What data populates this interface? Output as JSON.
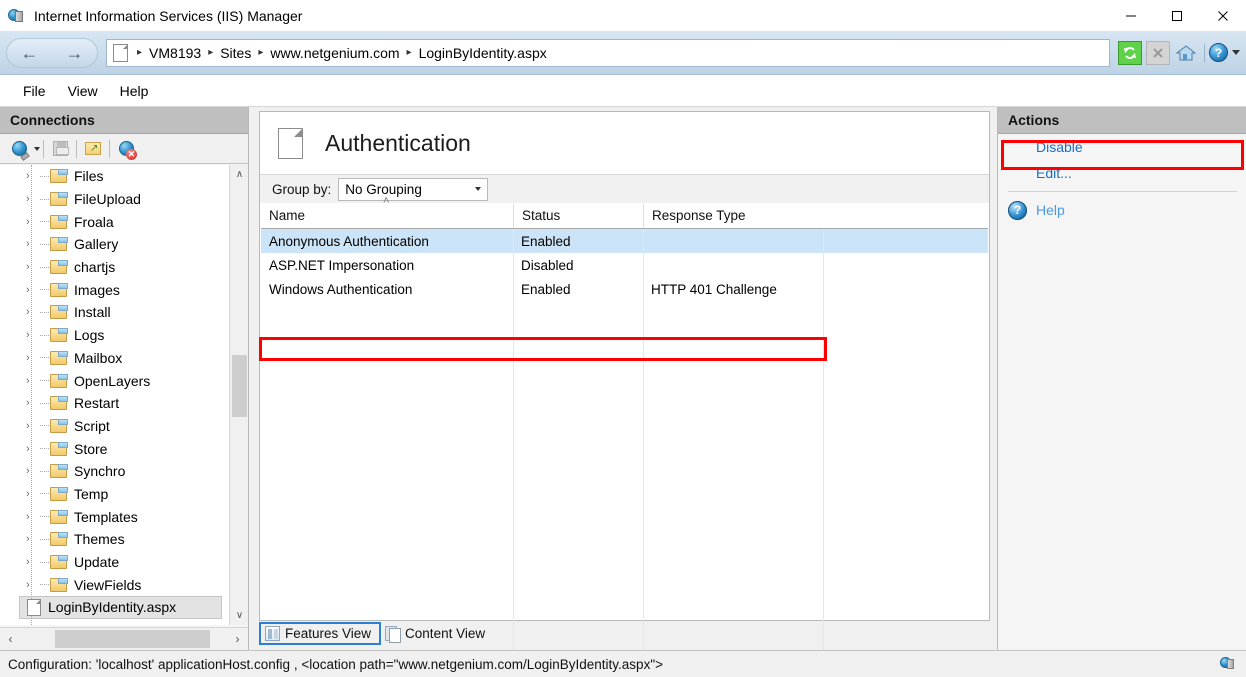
{
  "window": {
    "title": "Internet Information Services (IIS) Manager",
    "icon": "iis-server-icon",
    "minimize": "—",
    "maximize": "□",
    "close": "✕"
  },
  "address_bar": {
    "back_arrow": "←",
    "forward_arrow": "→",
    "page_icon": "page-icon",
    "separator": "▸",
    "breadcrumbs": [
      "VM8193",
      "Sites",
      "www.netgenium.com",
      "LoginByIdentity.aspx"
    ],
    "tools": [
      {
        "name": "refresh-icon",
        "glyph": "↻"
      },
      {
        "name": "stop-icon",
        "glyph": "✕"
      },
      {
        "name": "home-icon",
        "glyph": "⌂"
      },
      {
        "name": "help-icon",
        "glyph": "?"
      }
    ]
  },
  "menu": {
    "items": [
      "File",
      "View",
      "Help"
    ]
  },
  "connections": {
    "header": "Connections",
    "toolbar": [
      {
        "name": "connect-icon",
        "label": "Connect"
      },
      {
        "name": "save-connections-icon",
        "label": "Save"
      },
      {
        "name": "open-folder-icon",
        "label": "Open"
      },
      {
        "name": "disconnect-icon",
        "label": "Disconnect"
      }
    ],
    "tree": [
      {
        "label": "Files",
        "type": "folder",
        "expandable": true,
        "selected": false
      },
      {
        "label": "FileUpload",
        "type": "folder",
        "expandable": true,
        "selected": false
      },
      {
        "label": "Froala",
        "type": "folder",
        "expandable": true,
        "selected": false
      },
      {
        "label": "Gallery",
        "type": "folder",
        "expandable": true,
        "selected": false
      },
      {
        "label": "chartjs",
        "type": "folder",
        "expandable": true,
        "selected": false
      },
      {
        "label": "Images",
        "type": "folder",
        "expandable": true,
        "selected": false
      },
      {
        "label": "Install",
        "type": "folder",
        "expandable": true,
        "selected": false
      },
      {
        "label": "Logs",
        "type": "folder",
        "expandable": true,
        "selected": false
      },
      {
        "label": "Mailbox",
        "type": "folder",
        "expandable": true,
        "selected": false
      },
      {
        "label": "OpenLayers",
        "type": "folder",
        "expandable": true,
        "selected": false
      },
      {
        "label": "Restart",
        "type": "folder",
        "expandable": true,
        "selected": false
      },
      {
        "label": "Script",
        "type": "folder",
        "expandable": true,
        "selected": false
      },
      {
        "label": "Store",
        "type": "folder",
        "expandable": true,
        "selected": false
      },
      {
        "label": "Synchro",
        "type": "folder",
        "expandable": true,
        "selected": false
      },
      {
        "label": "Temp",
        "type": "folder",
        "expandable": true,
        "selected": false
      },
      {
        "label": "Templates",
        "type": "folder",
        "expandable": true,
        "selected": false
      },
      {
        "label": "Themes",
        "type": "folder",
        "expandable": true,
        "selected": false
      },
      {
        "label": "Update",
        "type": "folder",
        "expandable": true,
        "selected": false
      },
      {
        "label": "ViewFields",
        "type": "folder",
        "expandable": true,
        "selected": false
      },
      {
        "label": "LoginByIdentity.aspx",
        "type": "file",
        "expandable": false,
        "selected": true
      }
    ],
    "scroll_up": "∧",
    "scroll_down": "∨",
    "scroll_left": "‹",
    "scroll_right": "›"
  },
  "feature": {
    "icon": "page-icon",
    "title": "Authentication",
    "group_by_label": "Group by:",
    "group_by_value": "No Grouping",
    "sort_indicator": "˄",
    "columns": [
      "Name",
      "Status",
      "Response Type"
    ],
    "rows": [
      {
        "name": "Anonymous Authentication",
        "status": "Enabled",
        "response_type": "",
        "selected": true,
        "highlighted": true
      },
      {
        "name": "ASP.NET Impersonation",
        "status": "Disabled",
        "response_type": "",
        "selected": false,
        "highlighted": false
      },
      {
        "name": "Windows Authentication",
        "status": "Enabled",
        "response_type": "HTTP 401 Challenge",
        "selected": false,
        "highlighted": false
      }
    ]
  },
  "view_tabs": [
    {
      "label": "Features View",
      "icon": "features-view-icon",
      "active": true
    },
    {
      "label": "Content View",
      "icon": "content-view-icon",
      "active": false
    }
  ],
  "actions": {
    "header": "Actions",
    "items": [
      {
        "label": "Disable",
        "highlighted": true
      },
      {
        "label": "Edit...",
        "highlighted": false
      }
    ],
    "help": {
      "label": "Help",
      "icon": "help-icon",
      "glyph": "?"
    }
  },
  "status_bar": {
    "text": "Configuration: 'localhost' applicationHost.config , <location path=\"www.netgenium.com/LoginByIdentity.aspx\">",
    "right_icon": "iis-status-icon"
  },
  "colors": {
    "accent_link": "#1a6fc4",
    "selection_blue": "#cce4f7",
    "highlight_red": "#ff0000",
    "pane_header_grey": "#bfbfbf",
    "addressbar_blue": "#cbdcec"
  }
}
